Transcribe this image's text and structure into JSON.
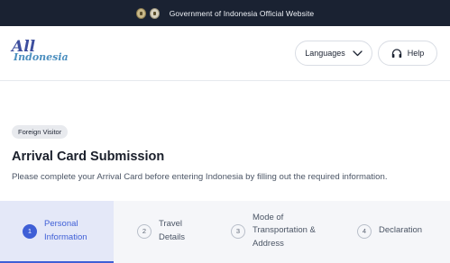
{
  "gov_bar": {
    "text": "Government of Indonesia Official Website",
    "emblems": [
      "national-emblem-icon",
      "ministry-emblem-icon"
    ],
    "background": "#1a2232"
  },
  "header": {
    "logo_line1": "All",
    "logo_line2": "Indonesia",
    "languages_label": "Languages",
    "help_label": "Help"
  },
  "main": {
    "badge": "Foreign Visitor",
    "title": "Arrival Card Submission",
    "subtitle": "Please complete your Arrival Card before entering Indonesia by filling out the required information."
  },
  "steps": [
    {
      "number": "1",
      "label": "Personal Information",
      "active": true
    },
    {
      "number": "2",
      "label": "Travel Details",
      "active": false
    },
    {
      "number": "3",
      "label": "Mode of Transportation & Address",
      "active": false
    },
    {
      "number": "4",
      "label": "Declaration",
      "active": false
    }
  ],
  "colors": {
    "accent": "#3f5fd6",
    "active_step_bg": "#e4e8f8",
    "steps_bg": "#f5f6f9"
  }
}
